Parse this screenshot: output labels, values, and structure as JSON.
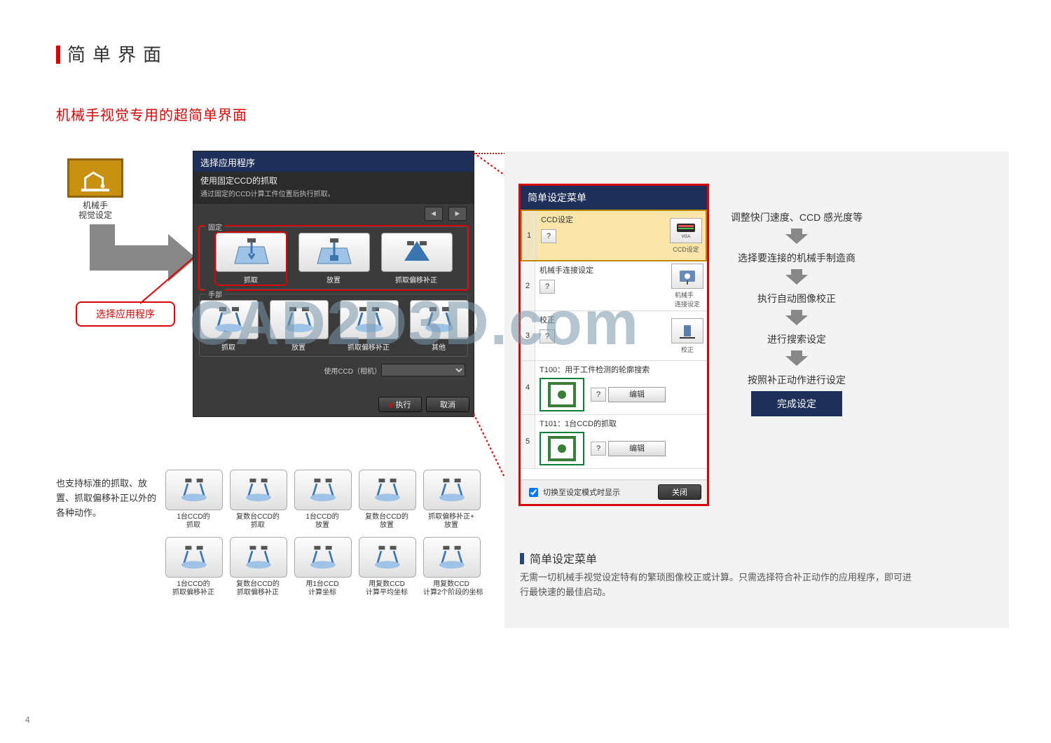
{
  "page": {
    "title": "简单界面",
    "subtitle": "机械手视觉专用的超简单界面",
    "number": "4"
  },
  "robot_card": {
    "line1": "机械手",
    "line2": "视觉设定"
  },
  "callout": {
    "label": "选择应用程序"
  },
  "app_panel": {
    "header": "选择应用程序",
    "sub": "使用固定CCD的抓取",
    "desc": "通过固定的CCD计算工件位置后执行抓取。",
    "group_fixed": "固定",
    "group_hand": "手部",
    "tiles_fixed": [
      {
        "label": "抓取",
        "selected": true
      },
      {
        "label": "放置"
      },
      {
        "label": "抓取偏移补正"
      }
    ],
    "tiles_hand": [
      {
        "label": "抓取"
      },
      {
        "label": "放置"
      },
      {
        "label": "抓取偏移补正"
      },
      {
        "label": "其他"
      }
    ],
    "usage_label": "使用CCD（相机）",
    "btn_exec": "执行",
    "btn_cancel": "取消",
    "nav_prev": "◄",
    "nav_next": "►"
  },
  "menu": {
    "header": "简单设定菜单",
    "items": [
      {
        "idx": "1",
        "title": "CCD设定",
        "right": "CCD设定",
        "active": true
      },
      {
        "idx": "2",
        "title": "机械手连接设定",
        "right": "机械手\n连接设定"
      },
      {
        "idx": "3",
        "title": "校正",
        "right": "校正"
      },
      {
        "idx": "4",
        "title": "T100：用于工件检测的轮廓搜索",
        "edit": "编辑"
      },
      {
        "idx": "5",
        "title": "T101：1台CCD的抓取",
        "edit": "编辑"
      }
    ],
    "foot_check": "切换至设定模式时显示",
    "foot_close": "关闭"
  },
  "desc": {
    "rows": [
      "调整快门速度、CCD 感光度等",
      "选择要连接的机械手制造商",
      "执行自动图像校正",
      "进行搜索设定",
      "按照补正动作进行设定"
    ],
    "done": "完成设定"
  },
  "right_section": {
    "title": "简单设定菜单",
    "para": "无需一切机械手视觉设定特有的繁琐图像校正或计算。只需选择符合补正动作的应用程序，即可进行最快速的最佳启动。"
  },
  "support_text": "也支持标准的抓取、放置、抓取偏移补正以外的各种动作。",
  "tiles": [
    "1台CCD的\n抓取",
    "复数台CCD的\n抓取",
    "1台CCD的\n放置",
    "复数台CCD的\n放置",
    "抓取偏移补正+\n放置",
    "1台CCD的\n抓取偏移补正",
    "复数台CCD的\n抓取偏移补正",
    "用1台CCD\n计算坐标",
    "用复数CCD\n计算平均坐标",
    "用复数CCD\n计算2个阶段的坐标"
  ],
  "watermark": "CAD2D3D.com"
}
